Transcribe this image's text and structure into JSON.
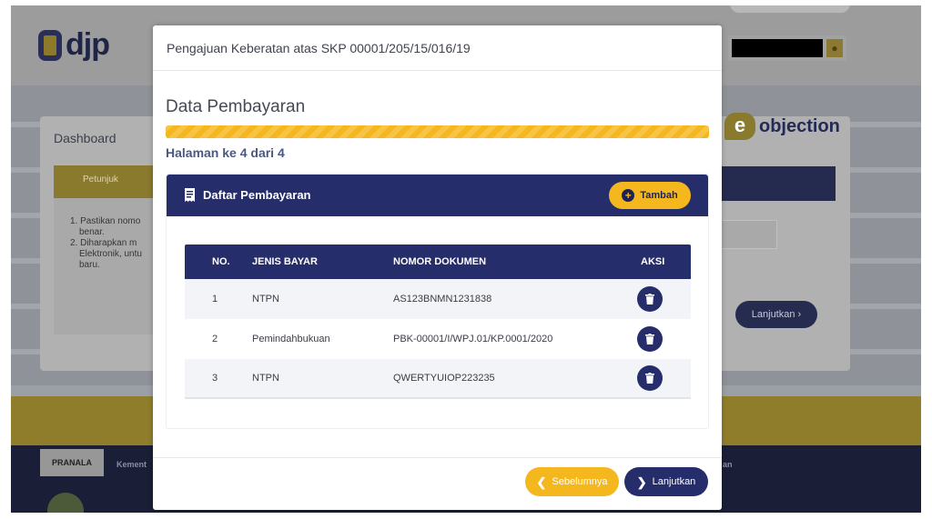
{
  "colors": {
    "accent_yellow": "#f5b71e",
    "navy": "#262d6b",
    "text_dark": "#3f4350",
    "page_info": "#4a5780"
  },
  "background": {
    "logo_text": "djp",
    "dashboard_title": "Dashboard",
    "petunjuk_label": "Petunjuk",
    "petunjuk_items": [
      "1. Pastikan nomo",
      "benar.",
      "2. Diharapkan m",
      "Elektronik, untu",
      "baru."
    ],
    "brand_text": "objection",
    "brand_mark": "e",
    "lanjutkan_label": "Lanjutkan",
    "footer_pranala": "PRANALA",
    "footer_kement": "Kement",
    "footer_right": "an"
  },
  "modal": {
    "title": "Pengajuan Keberatan atas SKP 00001/205/15/016/19",
    "section_title": "Data Pembayaran",
    "progress_fraction": 1.0,
    "page_info": "Halaman ke 4 dari 4",
    "panel": {
      "title": "Daftar Pembayaran",
      "icon": "receipt-icon",
      "add_button_label": "Tambah"
    },
    "table": {
      "headers": [
        "NO.",
        "JENIS BAYAR",
        "NOMOR DOKUMEN",
        "AKSI"
      ],
      "rows": [
        {
          "no": "1",
          "jenis": "NTPN",
          "nomor": "AS123BNMN1231838"
        },
        {
          "no": "2",
          "jenis": "Pemindahbukuan",
          "nomor": "PBK-00001/I/WPJ.01/KP.0001/2020"
        },
        {
          "no": "3",
          "jenis": "NTPN",
          "nomor": "QWERTYUIOP223235"
        }
      ]
    },
    "footer": {
      "prev_label": "Sebelumnya",
      "next_label": "Lanjutkan"
    }
  }
}
